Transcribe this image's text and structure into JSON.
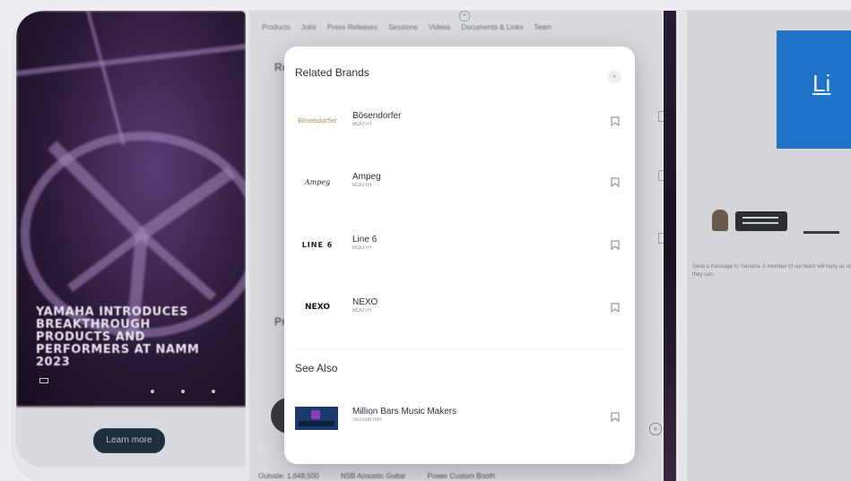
{
  "promo": {
    "headline": "Yamaha Introduces Breakthrough Products and Performers at NAMM 2023",
    "tag": "",
    "learn_more": "Learn more"
  },
  "page": {
    "tabs": [
      "Products",
      "Jobs",
      "Press Releases",
      "Sessions",
      "Videos",
      "Documents & Links",
      "Team"
    ],
    "related_heading_partial": "Rel",
    "products_heading_partial": "Pro",
    "bottom_items": [
      "Outside: 1,648,500",
      "NSB Acoustic Guitar",
      "Power Custom Booth"
    ]
  },
  "chat": {
    "button_label": "Li",
    "message": "Send a message to Yamaha. A member of our team will reply as soon as they can."
  },
  "modal": {
    "title": "Related Brands",
    "close_label": "×",
    "brands": [
      {
        "name": "Bösendorfer",
        "sub": "BOOTH",
        "logo": "Bösendorfer"
      },
      {
        "name": "Ampeg",
        "sub": "BOOTH",
        "logo": "Ampeg"
      },
      {
        "name": "Line 6",
        "sub": "BOOTH",
        "logo": "LINE 6"
      },
      {
        "name": "NEXO",
        "sub": "BOOTH",
        "logo": "NEXO"
      }
    ],
    "see_also_title": "See Also",
    "see_also_item": {
      "name": "Million Bars Music Makers",
      "sub": "Session Info"
    }
  }
}
